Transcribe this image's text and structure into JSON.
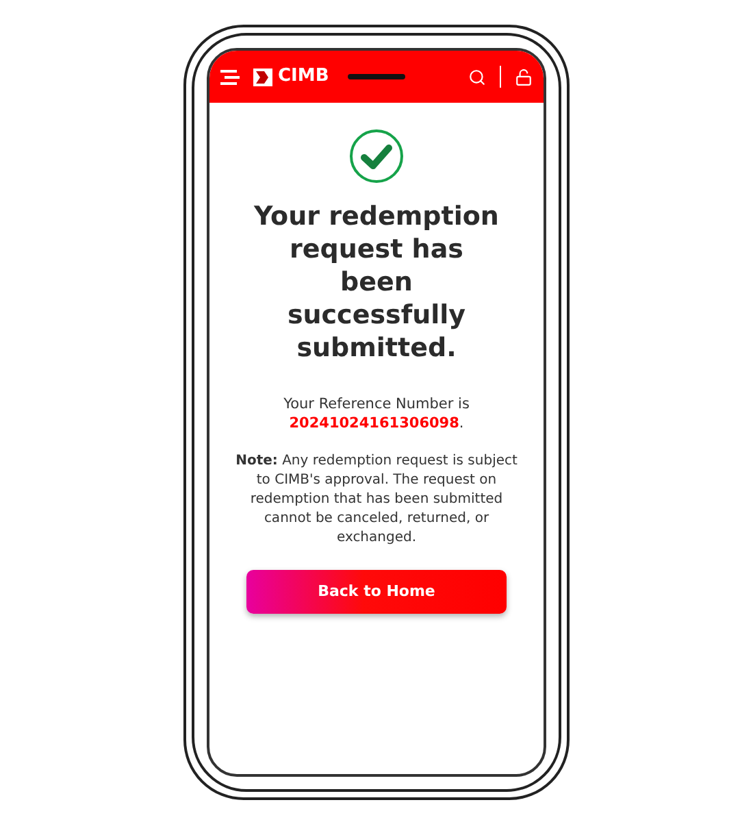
{
  "header": {
    "brand": "CIMB"
  },
  "message": {
    "title": "Your redemption request has been successfully submitted.",
    "reference_prefix": "Your Reference Number is ",
    "reference_number": "20241024161306098",
    "reference_suffix": ".",
    "note": "**Note:** Any redemption request is subject to CIMB's approval. The request on redemption that has been submitted cannot be canceled, returned, or exchanged."
  },
  "button": {
    "label": "Back to Home"
  }
}
